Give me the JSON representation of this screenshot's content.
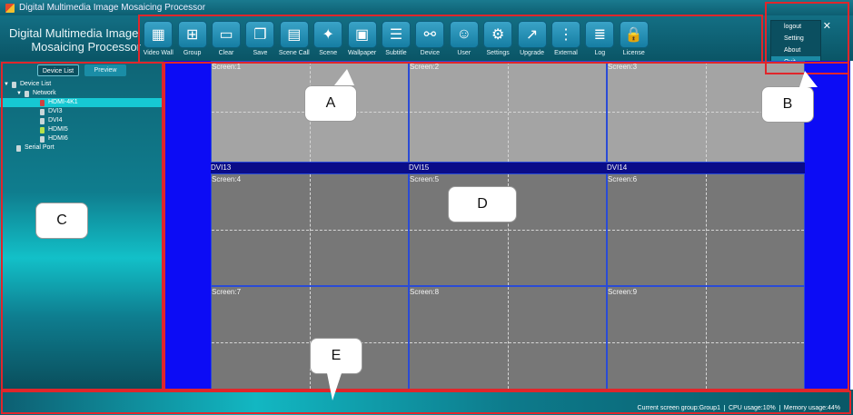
{
  "window": {
    "title": "Digital Multimedia Image Mosaicing Processor"
  },
  "brand": {
    "line1": "Digital Multimedia Image",
    "line2": "Mosaicing Processor"
  },
  "toolbar": [
    {
      "label": "Video Wall",
      "icon": "video-wall-icon",
      "glyph": "▦"
    },
    {
      "label": "Group",
      "icon": "group-icon",
      "glyph": "⊞"
    },
    {
      "label": "Clear",
      "icon": "clear-icon",
      "glyph": "▭"
    },
    {
      "label": "Save",
      "icon": "save-icon",
      "glyph": "❐"
    },
    {
      "label": "Scene Call",
      "icon": "scene-call-icon",
      "glyph": "▤"
    },
    {
      "label": "Scene",
      "icon": "scene-icon",
      "glyph": "✦"
    },
    {
      "label": "Wallpaper",
      "icon": "wallpaper-icon",
      "glyph": "▣"
    },
    {
      "label": "Subtitle",
      "icon": "subtitle-icon",
      "glyph": "☰"
    },
    {
      "label": "Device",
      "icon": "device-icon",
      "glyph": "⚯"
    },
    {
      "label": "User",
      "icon": "user-icon",
      "glyph": "☺"
    },
    {
      "label": "Settings",
      "icon": "settings-icon",
      "glyph": "⚙"
    },
    {
      "label": "Upgrade",
      "icon": "upgrade-icon",
      "glyph": "↗"
    },
    {
      "label": "External",
      "icon": "external-icon",
      "glyph": "⋮"
    },
    {
      "label": "Log",
      "icon": "log-icon",
      "glyph": "≣"
    },
    {
      "label": "License",
      "icon": "license-icon",
      "glyph": "🔒"
    }
  ],
  "window_menu": {
    "items": [
      "logout",
      "Setting",
      "About",
      "Quit"
    ],
    "selected": "Quit"
  },
  "left_panel": {
    "tabs": [
      "Device List",
      "Preview"
    ],
    "active_tab": "Device List",
    "tree": [
      {
        "label": "Device List",
        "level": 0,
        "expanded": true
      },
      {
        "label": "Network",
        "level": 1,
        "expanded": true
      },
      {
        "label": "HDMI-4K1",
        "level": 2,
        "selected": true
      },
      {
        "label": "DVI3",
        "level": 2
      },
      {
        "label": "DVI4",
        "level": 2
      },
      {
        "label": "HDMI5",
        "level": 2
      },
      {
        "label": "HDMI6",
        "level": 2
      },
      {
        "label": "Serial Port",
        "level": 1
      }
    ]
  },
  "screens": [
    {
      "label": "Screen:1"
    },
    {
      "label": "Screen:2"
    },
    {
      "label": "Screen:3"
    },
    {
      "label": "Screen:4"
    },
    {
      "label": "Screen:5"
    },
    {
      "label": "Screen:6"
    },
    {
      "label": "Screen:7"
    },
    {
      "label": "Screen:8"
    },
    {
      "label": "Screen:9"
    }
  ],
  "windows_on_wall": [
    "DVI13",
    "DVI15",
    "DVI14"
  ],
  "status": {
    "group": "Current screen group:Group1",
    "cpu": "CPU usage:10%",
    "memory": "Memory usage:44%"
  },
  "annotations": [
    "A",
    "B",
    "C",
    "D",
    "E"
  ],
  "colors": {
    "accent": "#136f84",
    "wall_bg": "#0c0cf5",
    "highlight": "#e0262b"
  }
}
